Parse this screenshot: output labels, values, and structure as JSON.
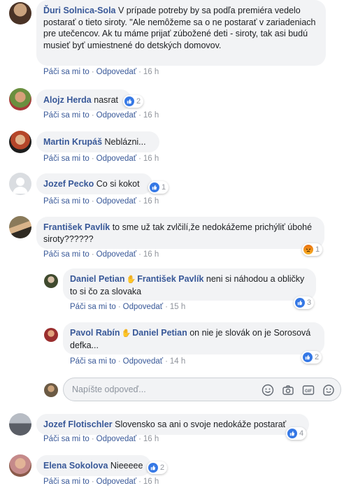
{
  "actions": {
    "like": "Páči sa mi to",
    "reply": "Odpovedať",
    "dot": "·"
  },
  "comments": [
    {
      "author": "Ďuri Solnica-Sola",
      "text": "V prípade potreby by sa podľa premiéra vedelo postarať o tieto siroty. \"Ale nemôžeme sa o ne postarať v zariadeniach pre utečencov. Ak tu máme prijať zúbožené deti - siroty, tak asi budú musieť byť umiestnené do detských domovov.",
      "time": "16 h"
    },
    {
      "author": "Alojz Herda",
      "text": "nasrat",
      "time": "16 h",
      "reaction_count": "2"
    },
    {
      "author": "Martin Krupáš",
      "text": "Neblázni...",
      "time": "16 h"
    },
    {
      "author": "Jozef Pecko",
      "text": "Co si kokot",
      "time": "16 h",
      "reaction_count": "1"
    },
    {
      "author": "František Pavlík",
      "text": "to sme už tak zvlčilí,že nedokážeme prichýliť úbohé siroty??????",
      "time": "16 h",
      "reaction_count": "1"
    },
    {
      "author": "Jozef Flotischler",
      "text": "Slovensko sa ani o svoje nedokáže postarať",
      "time": "16 h",
      "reaction_count": "4"
    },
    {
      "author": "Elena Sokolova",
      "text": "Nieeeee",
      "time": "16 h",
      "reaction_count": "2"
    }
  ],
  "replies": [
    {
      "author": "Daniel Petian",
      "mention": "František Pavlík",
      "text": "neni si náhodou a obličky to si čo za slovaka",
      "time": "15 h",
      "reaction_count": "3"
    },
    {
      "author": "Pavol Rabín",
      "mention": "Daniel Petian",
      "text": "on nie je slovák on je Sorosová defka...",
      "time": "14 h",
      "reaction_count": "2"
    }
  ],
  "reply_input": {
    "placeholder": "Napíšte odpoveď..."
  },
  "icons": [
    "emoji-icon",
    "camera-icon",
    "gif-icon",
    "sticker-icon",
    "like-icon",
    "angry-icon",
    "wave-icon"
  ],
  "colors": {
    "link": "#385898",
    "bubble": "#f2f3f5",
    "like": "#3578e5",
    "meta": "#90949c"
  }
}
